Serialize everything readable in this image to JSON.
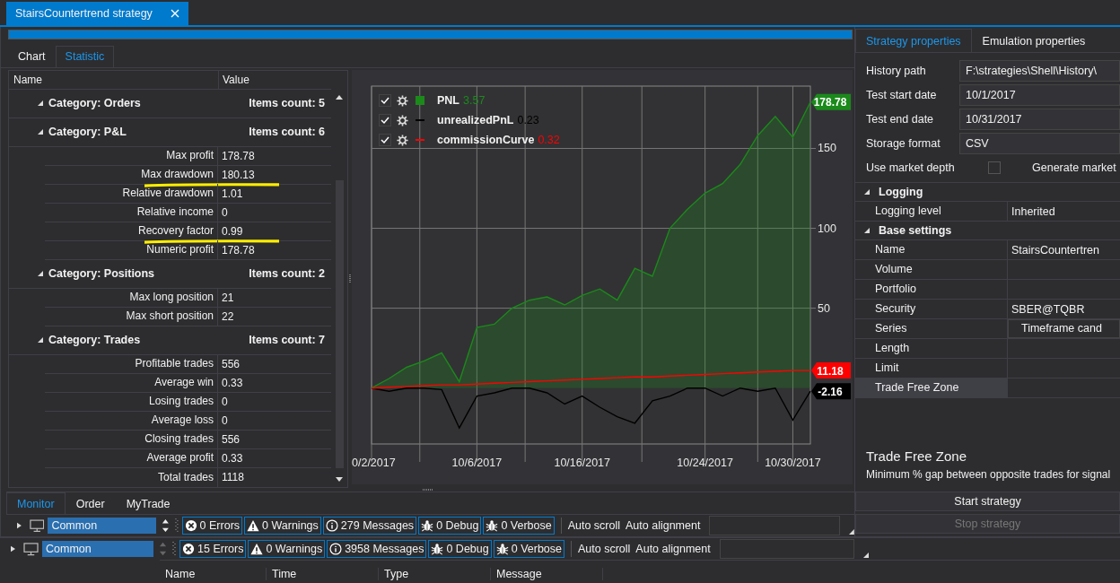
{
  "document_tab": {
    "title": "StairsCountertrend strategy"
  },
  "progress": {
    "level": 1
  },
  "view_tabs": [
    {
      "label": "Chart",
      "selected": false
    },
    {
      "label": "Statistic",
      "selected": true
    }
  ],
  "statistics": {
    "columns": [
      "Name",
      "Value"
    ],
    "groups": [
      {
        "title": "Category: Orders",
        "count": "Items count: 5",
        "expanded": true
      },
      {
        "title": "Category: P&L",
        "count": "Items count: 6",
        "expanded": true,
        "rows": [
          {
            "name": "Max profit",
            "value": "178.78"
          },
          {
            "name": "Max drawdown",
            "value": "180.13",
            "underlined": true
          },
          {
            "name": "Relative drawdown",
            "value": "1.01"
          },
          {
            "name": "Relative income",
            "value": "0"
          },
          {
            "name": "Recovery factor",
            "value": "0.99",
            "underlined": true
          },
          {
            "name": "Numeric profit",
            "value": "178.78"
          }
        ]
      },
      {
        "title": "Category: Positions",
        "count": "Items count: 2",
        "expanded": true,
        "rows": [
          {
            "name": "Max long position",
            "value": "21"
          },
          {
            "name": "Max short position",
            "value": "22"
          }
        ]
      },
      {
        "title": "Category: Trades",
        "count": "Items count: 7",
        "expanded": true,
        "rows": [
          {
            "name": "Profitable trades",
            "value": "556"
          },
          {
            "name": "Average win",
            "value": "0.33"
          },
          {
            "name": "Losing trades",
            "value": "0"
          },
          {
            "name": "Average loss",
            "value": "0"
          },
          {
            "name": "Closing trades",
            "value": "556"
          },
          {
            "name": "Average profit",
            "value": "0.33"
          },
          {
            "name": "Total trades",
            "value": "1118"
          }
        ]
      }
    ]
  },
  "chart_data": {
    "type": "line",
    "grid": true,
    "legend": "upper left",
    "ylim": [
      -35,
      189
    ],
    "categories": [
      "0/2/2017",
      null,
      null,
      null,
      null,
      null,
      "10/6/2017",
      null,
      null,
      null,
      null,
      null,
      "10/16/2017",
      null,
      null,
      null,
      null,
      null,
      null,
      "10/24/2017",
      null,
      null,
      null,
      null,
      "10/30/2017",
      null
    ],
    "yticks": [
      50,
      100,
      150
    ],
    "series": [
      {
        "name": "PNL",
        "color": "#1b8a1b",
        "values": [
          0,
          6,
          13,
          17,
          22,
          4,
          38,
          40,
          50,
          55,
          57,
          52,
          58,
          62,
          55,
          75,
          70,
          100,
          112,
          122,
          128,
          140,
          158,
          170,
          157,
          179
        ]
      },
      {
        "name": "unrealizedPnL",
        "color": "#000000",
        "values": [
          0,
          -2,
          0,
          0,
          -1,
          -25,
          -5,
          -3,
          0,
          0,
          -3,
          -10,
          -5,
          -12,
          -18,
          -22,
          -8,
          -5,
          0,
          0,
          -5,
          0,
          -2,
          0,
          -20,
          -2
        ]
      },
      {
        "name": "commissionCurve",
        "color": "#ff0000",
        "values": [
          0,
          0.5,
          1,
          1.5,
          2,
          2,
          2.5,
          3,
          3.5,
          4,
          4.5,
          5,
          5.5,
          6,
          6.5,
          7,
          7,
          7.5,
          8,
          8.5,
          9,
          9.5,
          10,
          10.5,
          11,
          11
        ]
      }
    ]
  },
  "legend": [
    {
      "checked": true,
      "filled": true,
      "value": "3.57"
    },
    {
      "checked": true,
      "filled": false,
      "value": "0.23"
    },
    {
      "checked": true,
      "filled": false,
      "value": "0.32"
    }
  ],
  "value_tags": [
    {
      "color": "#1b8a1b",
      "text": "178.78"
    },
    {
      "color": "#ff0000",
      "text": "11.18"
    },
    {
      "color": "#000000",
      "text": "-2.16"
    }
  ],
  "properties_tabs": [
    {
      "label": "Strategy properties",
      "selected": true
    },
    {
      "label": "Emulation properties",
      "selected": false
    }
  ],
  "form": [
    {
      "label": "History path",
      "value": "F:\\strategies\\Shell\\History\\"
    },
    {
      "label": "Test start date",
      "value": "10/1/2017"
    },
    {
      "label": "Test end date",
      "value": "10/31/2017"
    },
    {
      "label": "Storage format",
      "value": "CSV"
    }
  ],
  "checkbox_row": {
    "label": "Use market depth",
    "checked": false,
    "next_label": "Generate market"
  },
  "property_grid": [
    {
      "title": "Logging",
      "expanded": true,
      "rows": [
        {
          "name": "Logging level",
          "value": "Inherited",
          "kind": "text",
          "selected": false
        }
      ]
    },
    {
      "title": "Base settings",
      "expanded": true,
      "rows": [
        {
          "name": "Name",
          "value": "StairsCountertren",
          "kind": "text",
          "selected": false
        },
        {
          "name": "Volume",
          "kind": "text",
          "selected": false
        },
        {
          "name": "Portfolio",
          "kind": "text",
          "selected": false
        },
        {
          "name": "Security",
          "value": "SBER@TQBR",
          "kind": "text",
          "selected": false
        },
        {
          "name": "Series",
          "value": "Timeframe cand",
          "kind": "combo",
          "selected": false
        },
        {
          "name": "Length",
          "kind": "text",
          "selected": false
        },
        {
          "name": "Limit",
          "kind": "text",
          "selected": false
        },
        {
          "name": "Trade Free Zone",
          "kind": "text",
          "selected": true
        }
      ]
    }
  ],
  "description": {
    "title": "Trade Free Zone",
    "text": "Minimum % gap between opposite trades for signal"
  },
  "actions": [
    {
      "label": "Start strategy",
      "disabled": false
    },
    {
      "label": "Stop strategy",
      "disabled": true
    }
  ],
  "monitor": {
    "tabs": [
      {
        "label": "Monitor",
        "selected": true
      },
      {
        "label": "Order",
        "selected": false
      },
      {
        "label": "MyTrade",
        "selected": false
      }
    ],
    "toolbar": {
      "source": "Common",
      "filters": [
        {
          "kind": "error",
          "label": "0 Errors",
          "on": true
        },
        {
          "kind": "warning",
          "label": "0 Warnings",
          "on": true
        },
        {
          "kind": "info",
          "label": "279 Messages",
          "on": true
        },
        {
          "kind": "debug",
          "label": "0 Debug",
          "on": true
        },
        {
          "kind": "verbose",
          "label": "0 Verbose",
          "on": true
        }
      ],
      "auto_scroll": "Auto scroll",
      "auto_alignment": "Auto alignment"
    }
  },
  "log": {
    "toolbar": {
      "source": "Common",
      "filters": [
        {
          "kind": "error",
          "label": "15 Errors",
          "on": true
        },
        {
          "kind": "warning",
          "label": "0 Warnings",
          "on": true
        },
        {
          "kind": "info",
          "label": "3958 Messages",
          "on": true
        },
        {
          "kind": "debug",
          "label": "0 Debug",
          "on": true
        },
        {
          "kind": "verbose",
          "label": "0 Verbose",
          "on": true
        }
      ],
      "auto_scroll": "Auto scroll",
      "auto_alignment": "Auto alignment"
    },
    "columns": [
      "Name",
      "Time",
      "Type",
      "Message"
    ]
  }
}
